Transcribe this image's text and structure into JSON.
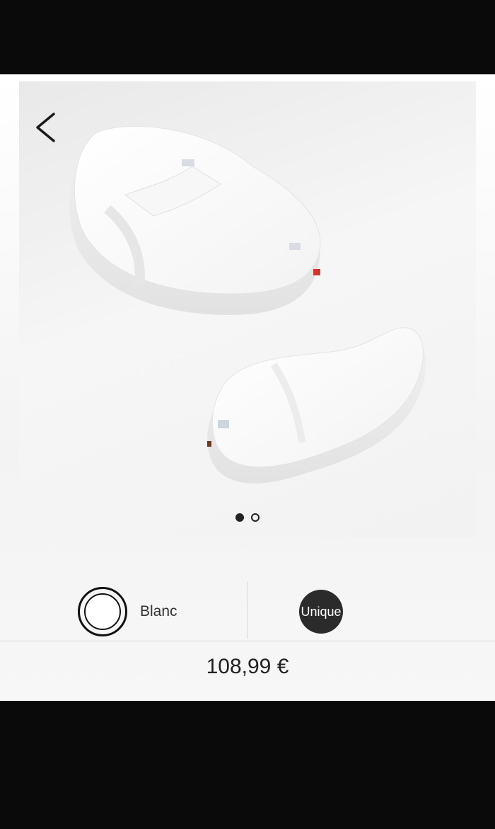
{
  "gallery": {
    "images": [
      {
        "icon": "baby-nest-mattress-image",
        "alt": ""
      },
      {
        "icon": "baby-nest-mattress-image",
        "alt": ""
      }
    ],
    "current_index": 1,
    "total": 2
  },
  "options": {
    "color": {
      "label": "Blanc",
      "swatch_color": "#ffffff"
    },
    "size": {
      "label": "Unique"
    }
  },
  "price": "108,99 €",
  "colors": {
    "background": "#0a0a0a",
    "accent": "#2b2b2b"
  }
}
